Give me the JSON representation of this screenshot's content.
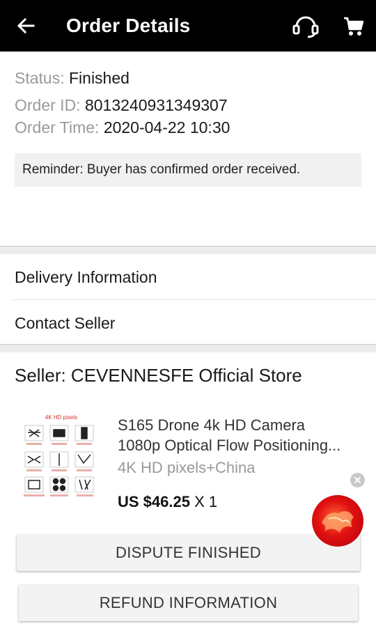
{
  "header": {
    "title": "Order Details",
    "back_icon": "back-arrow-icon",
    "support_icon": "headset-icon",
    "cart_icon": "cart-icon"
  },
  "order": {
    "status_label": "Status:",
    "status_value": "Finished",
    "id_label": "Order ID:",
    "id_value": "8013240931349307",
    "time_label": "Order Time:",
    "time_value": "2020-04-22 10:30",
    "reminder": "Reminder: Buyer has confirmed order received."
  },
  "links": {
    "delivery": "Delivery Information",
    "contact": "Contact Seller"
  },
  "seller": {
    "label": "Seller: CEVENNESFE Official Store"
  },
  "product": {
    "title_line1": "S165 Drone 4k HD Camera",
    "title_line2": "1080p Optical Flow Positioning...",
    "variant": "4K HD pixels+China",
    "price": "US $46.25",
    "quantity": "X 1",
    "thumb_heading": "4K HD pixels"
  },
  "buttons": {
    "dispute": "DISPUTE FINISHED",
    "refund": "REFUND INFORMATION"
  },
  "colors": {
    "header_bg": "#000000",
    "muted_text": "#9a9a9a",
    "float_ball": "#d81414"
  }
}
